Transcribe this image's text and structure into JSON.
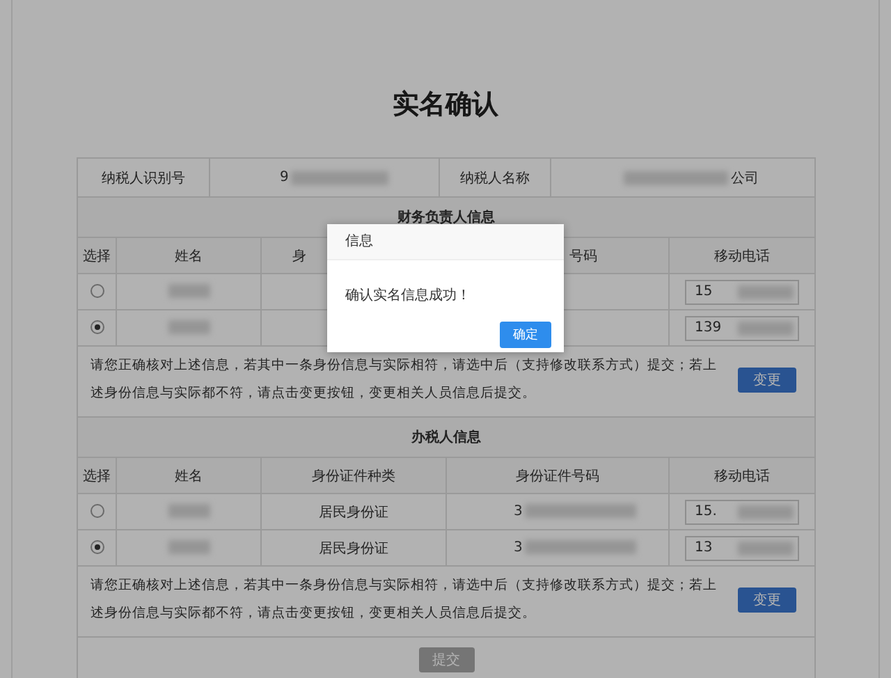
{
  "page": {
    "title": "实名确认"
  },
  "taxpayer": {
    "id_label": "纳税人识别号",
    "id_value": "9",
    "name_label": "纳税人名称",
    "name_value": "公司"
  },
  "sections": [
    {
      "title": "财务负责人信息",
      "columns": [
        {
          "label": "选择"
        },
        {
          "label": "姓名"
        },
        {
          "label": "身",
          "partial": true
        },
        {
          "label": "号码",
          "partial": true
        },
        {
          "label": "移动电话"
        }
      ],
      "rows": [
        {
          "selected": false,
          "phone": "15"
        },
        {
          "selected": true,
          "phone": "139"
        }
      ],
      "note": "请您正确核对上述信息，若其中一条身份信息与实际相符，请选中后（支持修改联系方式）提交；若上述身份信息与实际都不符，请点击变更按钮，变更相关人员信息后提交。",
      "change_button": "变更"
    },
    {
      "title": "办税人信息",
      "columns": [
        {
          "label": "选择"
        },
        {
          "label": "姓名"
        },
        {
          "label": "身份证件种类"
        },
        {
          "label": "身份证件号码"
        },
        {
          "label": "移动电话"
        }
      ],
      "rows": [
        {
          "selected": false,
          "id_type": "居民身份证",
          "id_number": "3",
          "phone": "15."
        },
        {
          "selected": true,
          "id_type": "居民身份证",
          "id_number": "3",
          "phone": "13"
        }
      ],
      "note": "请您正确核对上述信息，若其中一条身份信息与实际相符，请选中后（支持修改联系方式）提交；若上述身份信息与实际都不符，请点击变更按钮，变更相关人员信息后提交。",
      "change_button": "变更"
    }
  ],
  "submit": {
    "label": "提交",
    "disabled": true
  },
  "dialog": {
    "title": "信息",
    "message": "确认实名信息成功！",
    "ok": "确定"
  }
}
